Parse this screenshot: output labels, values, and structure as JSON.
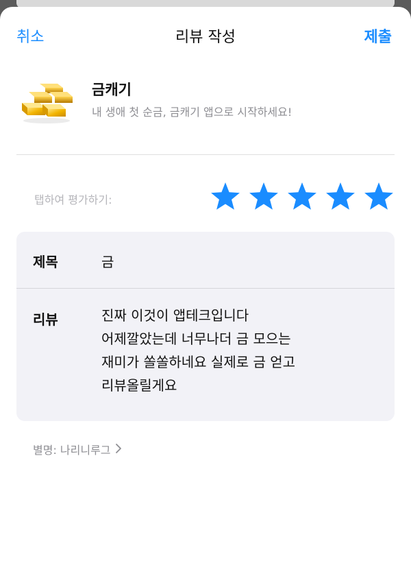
{
  "nav": {
    "cancel_label": "취소",
    "title": "리뷰 작성",
    "submit_label": "제출"
  },
  "app": {
    "name": "금캐기",
    "subtitle": "내 생애 첫 순금, 금캐기 앱으로 시작하세요!",
    "icon": "gold-bars-icon"
  },
  "rating": {
    "label": "탭하여 평가하기:",
    "value": 5,
    "max": 5,
    "star_color": "#1a8cff"
  },
  "form": {
    "title_label": "제목",
    "title_value": "금",
    "review_label": "리뷰",
    "review_lines": [
      "진짜 이것이 앱테크입니다",
      "어제깔았는데 너무나더 금 모으는",
      "재미가 쏠쏠하네요 실제로 금 얻고",
      "리뷰올릴게요"
    ]
  },
  "nickname": {
    "text": "별명: 나리니루그",
    "chevron_icon": "chevron-right-icon"
  },
  "colors": {
    "accent": "#1a8cff",
    "card_bg": "#f2f2f7",
    "secondary_text": "#8e8e93"
  }
}
